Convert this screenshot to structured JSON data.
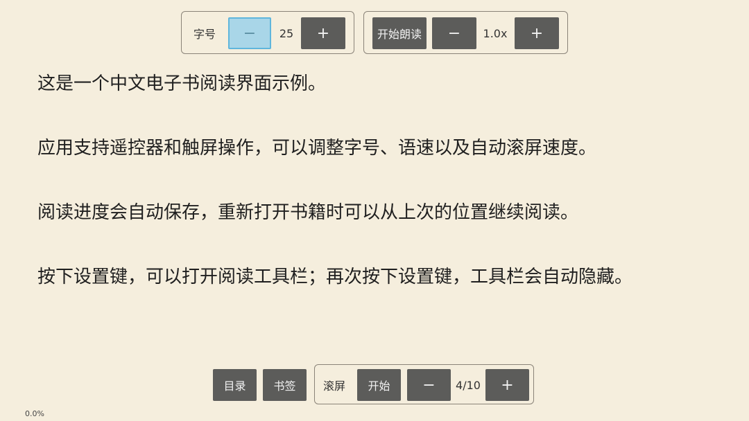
{
  "top_toolbar": {
    "font_size_label": "字号",
    "font_decrease": "−",
    "font_size_value": "25",
    "font_increase": "+",
    "start_reading": "开始朗读",
    "speed_decrease": "−",
    "speed_value": "1.0x",
    "speed_increase": "+"
  },
  "content": {
    "paragraphs": [
      "这是一个中文电子书阅读界面示例。",
      "应用支持遥控器和触屏操作，可以调整字号、语速以及自动滚屏速度。",
      "阅读进度会自动保存，重新打开书籍时可以从上次的位置继续阅读。",
      "按下设置键，可以打开阅读工具栏；再次按下设置键，工具栏会自动隐藏。"
    ]
  },
  "bottom_toolbar": {
    "toc": "目录",
    "bookmark": "书签",
    "scroll_label": "滚屏",
    "scroll_start": "开始",
    "scroll_decrease": "−",
    "scroll_speed": "4/10",
    "scroll_increase": "+"
  },
  "status": {
    "progress": "0.0%"
  },
  "colors": {
    "background": "#f5eedd",
    "button": "#5c5c5a",
    "focus": "#5fb6dc"
  }
}
